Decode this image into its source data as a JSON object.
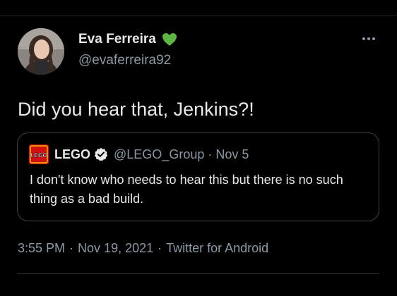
{
  "author": {
    "display_name": "Eva Ferreira",
    "handle": "@evaferreira92",
    "badge_icon": "green-heart-icon",
    "badge_color": "#5fb544"
  },
  "tweet": {
    "text": "Did you hear that, Jenkins?!"
  },
  "quoted_tweet": {
    "logo_icon": "lego-logo-icon",
    "logo_color": "#d01012",
    "display_name": "LEGO",
    "verified_icon": "verified-badge-icon",
    "handle": "@LEGO_Group",
    "separator": "·",
    "date": "Nov 5",
    "text": "I don't know who needs to hear this but there is no such thing as a bad build."
  },
  "meta": {
    "time": "3:55 PM",
    "separator": "·",
    "date": "Nov 19, 2021",
    "source": "Twitter for Android"
  },
  "menu": {
    "more_icon": "more-options-icon"
  },
  "colors": {
    "background": "#000000",
    "primary_text": "#e7e9ea",
    "secondary_text": "#8b98a5",
    "border": "#3b4248"
  }
}
